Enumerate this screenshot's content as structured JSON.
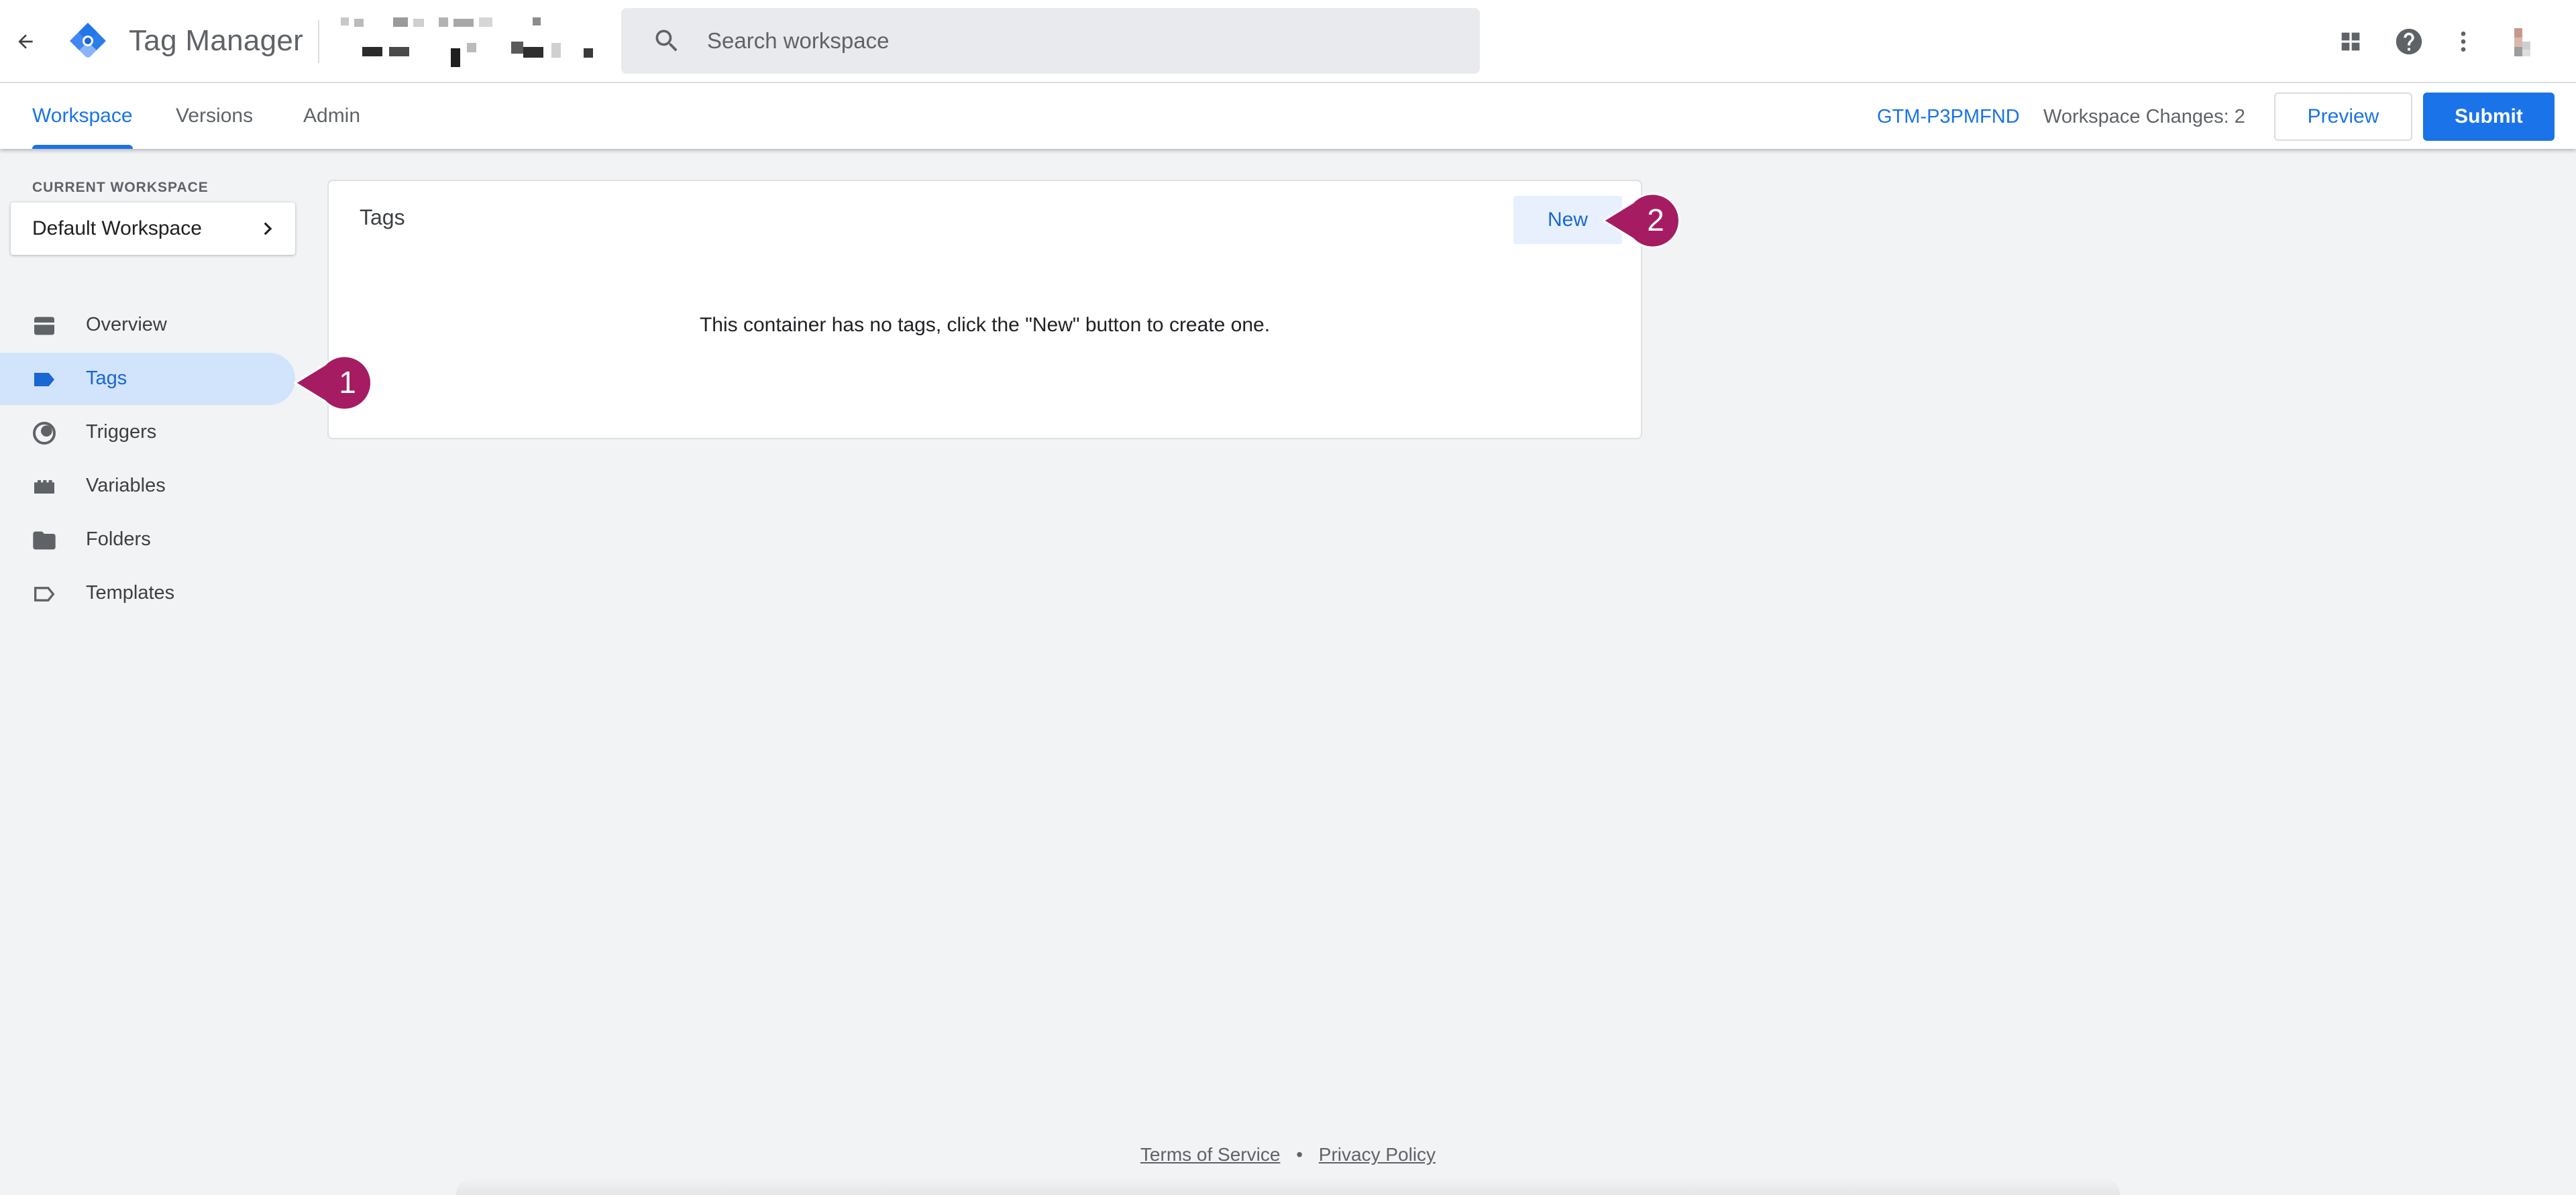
{
  "header": {
    "app_name": "Tag Manager",
    "search_placeholder": "Search workspace"
  },
  "subnav": {
    "tabs": [
      {
        "label": "Workspace",
        "active": true
      },
      {
        "label": "Versions",
        "active": false
      },
      {
        "label": "Admin",
        "active": false
      }
    ],
    "container_id": "GTM-P3PMFND",
    "workspace_changes": "Workspace Changes: 2",
    "preview_label": "Preview",
    "submit_label": "Submit"
  },
  "sidebar": {
    "current_workspace_label": "CURRENT WORKSPACE",
    "workspace_name": "Default Workspace",
    "items": [
      {
        "label": "Overview",
        "icon": "overview-icon",
        "active": false
      },
      {
        "label": "Tags",
        "icon": "tag-icon",
        "active": true
      },
      {
        "label": "Triggers",
        "icon": "trigger-icon",
        "active": false
      },
      {
        "label": "Variables",
        "icon": "variables-icon",
        "active": false
      },
      {
        "label": "Folders",
        "icon": "folder-icon",
        "active": false
      },
      {
        "label": "Templates",
        "icon": "template-icon",
        "active": false
      }
    ]
  },
  "main": {
    "card_title": "Tags",
    "new_label": "New",
    "empty_message": "This container has no tags, click the \"New\" button to create one."
  },
  "annotations": [
    "1",
    "2"
  ],
  "footer": {
    "terms": "Terms of Service",
    "separator": "•",
    "privacy": "Privacy Policy"
  },
  "colors": {
    "accent": "#1a73e8",
    "active_nav_bg": "#d2e3fc",
    "callout": "#a51c62",
    "page_bg": "#f1f3f4"
  }
}
